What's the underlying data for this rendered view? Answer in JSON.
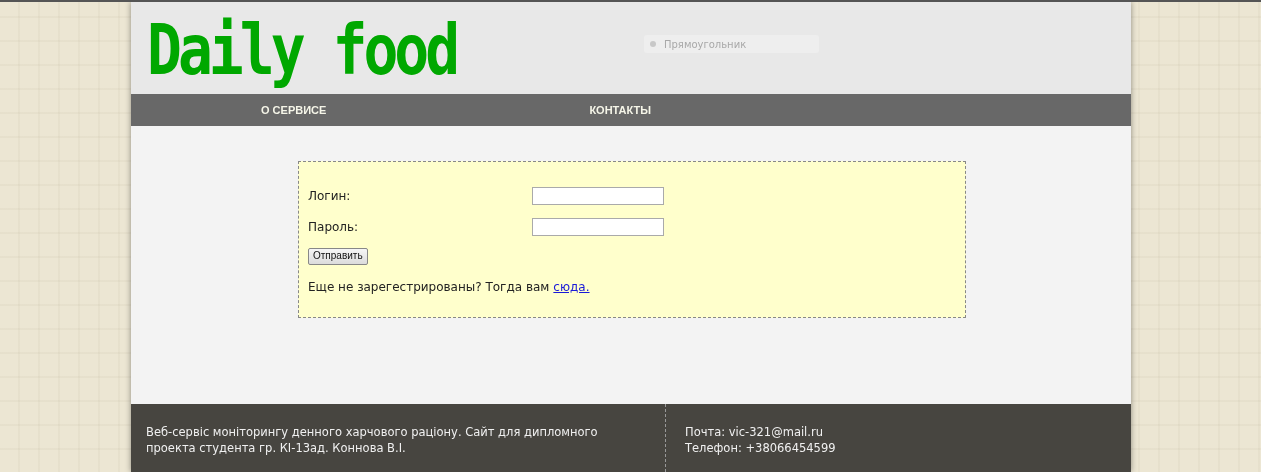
{
  "header": {
    "logo": "Daily food",
    "ghost_field": {
      "placeholder": "Прямоугольник"
    }
  },
  "nav": [
    "О СЕРВИСЕ",
    "КОНТАКТЫ"
  ],
  "login_form": {
    "fields": [
      {
        "label": "Логин:"
      },
      {
        "label": "Пароль:"
      }
    ],
    "submit": "Отправить",
    "register_prompt": "Еще не зарегестрированы? Тогда вам",
    "register_link": "сюда."
  },
  "footer": {
    "about": "Веб-сервіс моніторингу денного харчового раціону. Сайт для дипломного проекта студента гр. КІ-13ад. Коннова В.І.",
    "email": "Почта: vic-321@mail.ru",
    "phone": "Телефон: +38066454599"
  }
}
